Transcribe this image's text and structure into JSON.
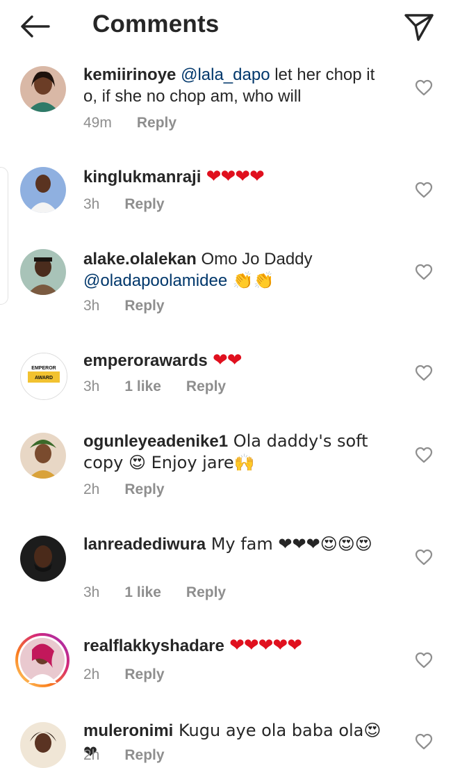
{
  "header": {
    "title": "Comments",
    "back_icon": "arrow-left-icon",
    "share_icon": "paper-plane-icon"
  },
  "comments": [
    {
      "username": "kemiirinoye",
      "mention": "@lala_dapo",
      "text": " let her chop it o, if she no chop am, who will",
      "time": "49m",
      "likes": "",
      "reply": "Reply"
    },
    {
      "username": "kinglukmanraji",
      "text": " ❤❤❤❤",
      "time": "3h",
      "likes": "",
      "reply": "Reply"
    },
    {
      "username": "alake.olalekan",
      "text": " Omo Jo Daddy ",
      "mention": "@oladapoolamidee",
      "text_after": " 👏👏",
      "time": "3h",
      "likes": "",
      "reply": "Reply"
    },
    {
      "username": "emperorawards",
      "text": " ❤❤",
      "time": "3h",
      "likes": "1 like",
      "reply": "Reply"
    },
    {
      "username": "ogunleyeadenike1",
      "text": " Ola daddy's soft copy 😍 Enjoy jare🙌",
      "time": "2h",
      "likes": "",
      "reply": "Reply"
    },
    {
      "username": "lanreadediwura",
      "text": " My fam ❤❤❤😍😍😍",
      "time": "3h",
      "likes": "1 like",
      "reply": "Reply"
    },
    {
      "username": "realflakkyshadare",
      "text": " ❤❤❤❤❤",
      "time": "2h",
      "likes": "",
      "reply": "Reply"
    },
    {
      "username": "muleronimi",
      "text": " Kugu aye ola baba ola😍❤",
      "time": "2h",
      "likes": "",
      "reply": "Reply"
    }
  ],
  "avatar_logo_text": "EMPEROR AWARD",
  "colors": {
    "mention": "#00376b",
    "meta": "#8e8e8e",
    "heart": "#e0101e",
    "story_ring": "#d6249f"
  }
}
